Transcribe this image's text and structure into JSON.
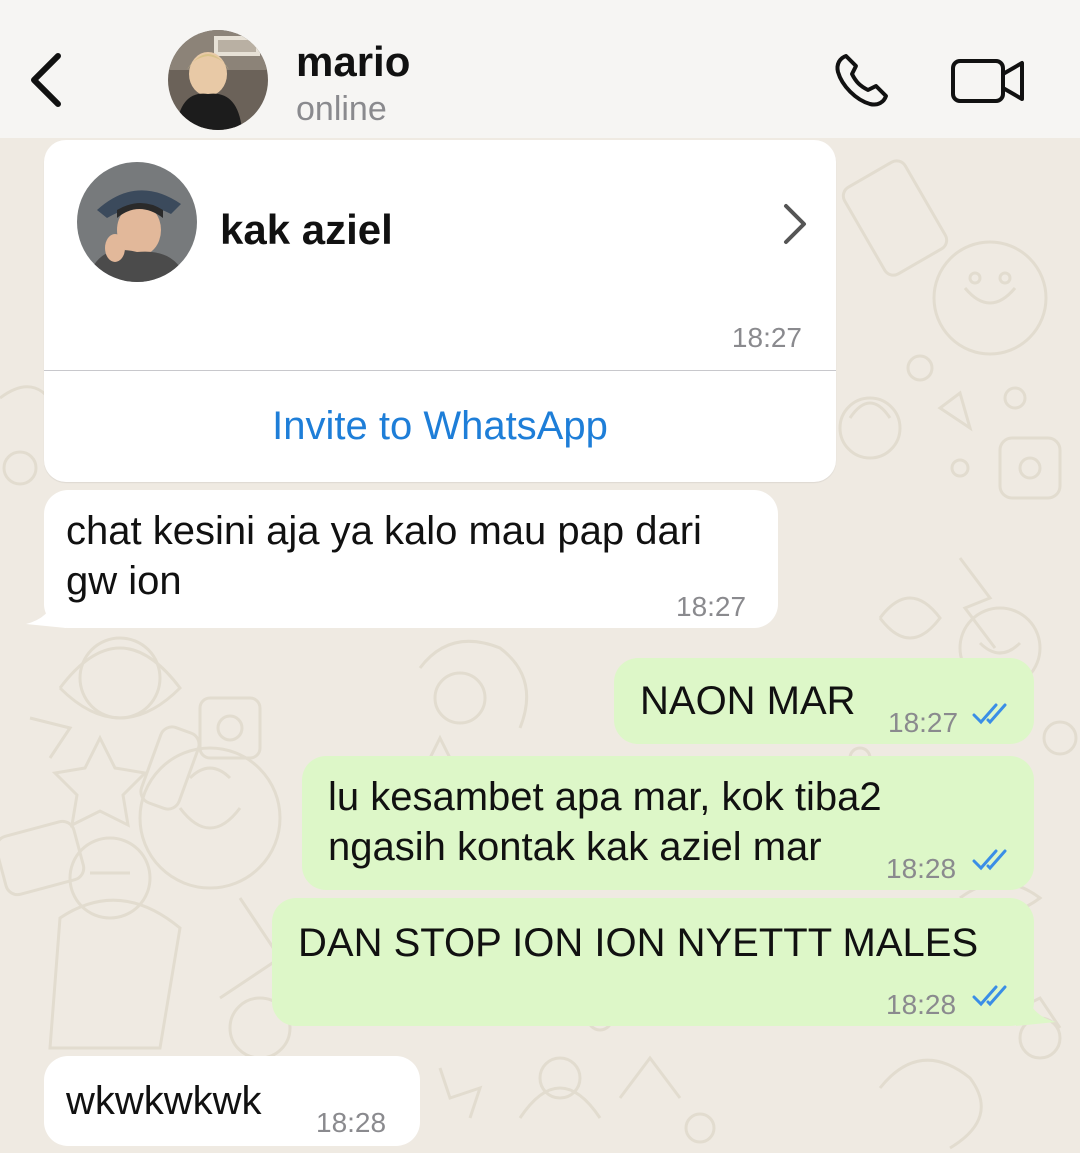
{
  "header": {
    "contact_name": "mario",
    "status": "online"
  },
  "contact_card": {
    "name": "kak aziel",
    "time": "18:27",
    "invite_label": "Invite to WhatsApp"
  },
  "messages": [
    {
      "direction": "in",
      "lines": [
        "chat kesini aja ya kalo mau pap dari",
        "gw ion"
      ],
      "time": "18:27"
    },
    {
      "direction": "out",
      "lines": [
        "NAON MAR"
      ],
      "time": "18:27",
      "read": true
    },
    {
      "direction": "out",
      "lines": [
        "lu kesambet apa mar, kok tiba2",
        "ngasih kontak kak aziel mar"
      ],
      "time": "18:28",
      "read": true
    },
    {
      "direction": "out",
      "lines": [
        "DAN STOP ION ION NYETTT MALES"
      ],
      "time": "18:28",
      "read": true
    },
    {
      "direction": "in",
      "lines": [
        "wkwkwkwk"
      ],
      "time": "18:28"
    }
  ],
  "colors": {
    "incoming_bubble": "#ffffff",
    "outgoing_bubble": "#ddf7c8",
    "read_tick": "#3a8ee6",
    "link": "#1e7ed8",
    "background": "#efeae2"
  },
  "icons": [
    "back-chevron-icon",
    "phone-icon",
    "video-camera-icon",
    "chevron-right-icon",
    "double-check-icon"
  ]
}
